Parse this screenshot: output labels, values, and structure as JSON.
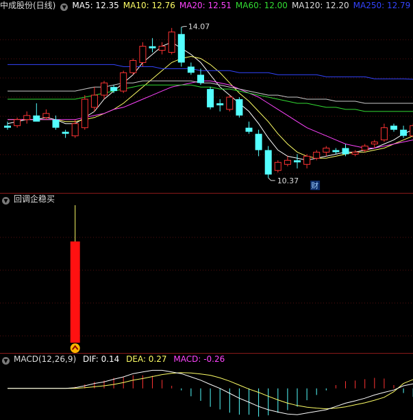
{
  "price_panel": {
    "title": "中成股份(日线)",
    "ma": [
      {
        "label": "MA5: 12.35",
        "color": "#ffffff"
      },
      {
        "label": "MA10: 12.76",
        "color": "#ffff66"
      },
      {
        "label": "MA20: 12.51",
        "color": "#ff44ff"
      },
      {
        "label": "MA60: 12.00",
        "color": "#33dd33"
      },
      {
        "label": "MA120: 12.20",
        "color": "#dddddd"
      },
      {
        "label": "MA250: 12.79",
        "color": "#3344ff"
      }
    ],
    "high_label": "14.07",
    "low_label": "10.37",
    "badge": "财",
    "up_color": "#ff3333",
    "down_color": "#54ffff"
  },
  "indicator_panel": {
    "title": "回调企稳买",
    "bar_color": "#ff1111"
  },
  "macd_panel": {
    "title": "MACD(12,26,9)",
    "dif": "DIF: 0.14",
    "dea": "DEA: 0.27",
    "macd": "MACD: -0.26",
    "dif_color": "#ffffff",
    "dea_color": "#ffff66",
    "macd_color": "#ff44ff"
  },
  "chart_data": {
    "type": "candlestick",
    "ohlc": [
      [
        11.65,
        11.75,
        11.55,
        11.6
      ],
      [
        11.65,
        11.85,
        11.6,
        11.8
      ],
      [
        11.8,
        12.0,
        11.7,
        11.9
      ],
      [
        11.9,
        12.2,
        11.85,
        11.75
      ],
      [
        11.85,
        12.05,
        11.8,
        11.95
      ],
      [
        11.8,
        11.9,
        11.55,
        11.6
      ],
      [
        11.5,
        11.55,
        11.35,
        11.45
      ],
      [
        11.4,
        11.8,
        11.35,
        11.7
      ],
      [
        11.6,
        12.4,
        11.55,
        12.3
      ],
      [
        12.1,
        12.6,
        12.0,
        12.4
      ],
      [
        12.4,
        12.75,
        12.3,
        12.7
      ],
      [
        12.6,
        12.65,
        12.45,
        12.5
      ],
      [
        12.5,
        13.0,
        12.45,
        12.95
      ],
      [
        12.95,
        13.3,
        12.9,
        13.25
      ],
      [
        13.2,
        13.7,
        13.1,
        13.6
      ],
      [
        13.6,
        13.8,
        13.45,
        13.55
      ],
      [
        13.5,
        13.7,
        13.4,
        13.6
      ],
      [
        13.45,
        14.05,
        13.4,
        13.95
      ],
      [
        13.9,
        14.07,
        13.1,
        13.2
      ],
      [
        13.1,
        13.2,
        12.9,
        12.95
      ],
      [
        12.9,
        13.05,
        12.65,
        12.7
      ],
      [
        12.55,
        12.6,
        12.05,
        12.1
      ],
      [
        12.2,
        12.3,
        12.0,
        12.15
      ],
      [
        12.05,
        12.4,
        12.0,
        12.35
      ],
      [
        12.3,
        12.35,
        11.85,
        11.9
      ],
      [
        11.6,
        11.75,
        11.45,
        11.5
      ],
      [
        11.45,
        11.55,
        10.9,
        11.05
      ],
      [
        11.05,
        11.15,
        10.37,
        10.45
      ],
      [
        10.55,
        10.8,
        10.5,
        10.75
      ],
      [
        10.7,
        10.9,
        10.65,
        10.8
      ],
      [
        10.8,
        10.95,
        10.6,
        10.75
      ],
      [
        10.7,
        10.95,
        10.6,
        10.9
      ],
      [
        10.85,
        11.05,
        10.8,
        11.0
      ],
      [
        11.0,
        11.15,
        10.9,
        11.1
      ],
      [
        11.05,
        11.1,
        10.95,
        11.0
      ],
      [
        11.1,
        11.2,
        10.9,
        10.95
      ],
      [
        10.95,
        11.05,
        10.9,
        11.0
      ],
      [
        11.05,
        11.2,
        11.0,
        11.15
      ],
      [
        11.2,
        11.3,
        11.1,
        11.25
      ],
      [
        11.3,
        11.7,
        11.25,
        11.6
      ],
      [
        11.65,
        11.7,
        11.5,
        11.55
      ],
      [
        11.55,
        11.65,
        11.35,
        11.4
      ],
      [
        11.4,
        11.7,
        11.35,
        11.65
      ]
    ],
    "ma_lines": {
      "MA5": [
        11.7,
        11.75,
        11.8,
        11.8,
        11.85,
        11.8,
        11.7,
        11.7,
        11.85,
        12.0,
        12.3,
        12.5,
        12.7,
        12.9,
        13.2,
        13.4,
        13.6,
        13.7,
        13.55,
        13.4,
        13.2,
        12.9,
        12.6,
        12.4,
        12.2,
        12.0,
        11.7,
        11.35,
        11.05,
        10.9,
        10.85,
        10.8,
        10.85,
        10.9,
        10.95,
        11.0,
        11.0,
        11.05,
        11.1,
        11.2,
        11.3,
        11.45,
        11.55
      ],
      "MA10": [
        11.8,
        11.8,
        11.8,
        11.8,
        11.8,
        11.8,
        11.75,
        11.75,
        11.8,
        11.85,
        11.95,
        12.05,
        12.2,
        12.4,
        12.6,
        12.8,
        13.0,
        13.2,
        13.3,
        13.35,
        13.3,
        13.15,
        12.95,
        12.7,
        12.45,
        12.25,
        12.0,
        11.75,
        11.45,
        11.2,
        11.0,
        10.9,
        10.85,
        10.85,
        10.9,
        10.95,
        11.0,
        11.0,
        11.05,
        11.1,
        11.2,
        11.3,
        11.4
      ],
      "MA20": [
        11.8,
        11.8,
        11.8,
        11.8,
        11.8,
        11.8,
        11.8,
        11.8,
        11.85,
        11.9,
        11.95,
        12.05,
        12.1,
        12.2,
        12.3,
        12.4,
        12.5,
        12.6,
        12.65,
        12.7,
        12.75,
        12.75,
        12.7,
        12.65,
        12.55,
        12.45,
        12.35,
        12.2,
        12.05,
        11.9,
        11.75,
        11.6,
        11.5,
        11.4,
        11.3,
        11.2,
        11.15,
        11.1,
        11.1,
        11.15,
        11.2,
        11.25,
        11.3
      ],
      "MA60": [
        12.3,
        12.3,
        12.3,
        12.3,
        12.3,
        12.3,
        12.3,
        12.3,
        12.35,
        12.4,
        12.45,
        12.5,
        12.55,
        12.6,
        12.65,
        12.65,
        12.65,
        12.65,
        12.65,
        12.65,
        12.6,
        12.6,
        12.55,
        12.55,
        12.5,
        12.45,
        12.4,
        12.35,
        12.3,
        12.25,
        12.2,
        12.2,
        12.15,
        12.1,
        12.1,
        12.05,
        12.05,
        12.0,
        12.0,
        12.0,
        12.0,
        12.0,
        12.0
      ],
      "MA120": [
        12.5,
        12.5,
        12.5,
        12.5,
        12.5,
        12.5,
        12.5,
        12.5,
        12.55,
        12.6,
        12.6,
        12.65,
        12.7,
        12.7,
        12.75,
        12.75,
        12.75,
        12.75,
        12.75,
        12.75,
        12.7,
        12.7,
        12.65,
        12.6,
        12.55,
        12.5,
        12.45,
        12.4,
        12.4,
        12.35,
        12.35,
        12.3,
        12.3,
        12.3,
        12.25,
        12.25,
        12.25,
        12.2,
        12.2,
        12.2,
        12.2,
        12.2,
        12.2
      ],
      "MA250": [
        13.15,
        13.15,
        13.15,
        13.15,
        13.15,
        13.15,
        13.15,
        13.15,
        13.15,
        13.15,
        13.15,
        13.15,
        13.1,
        13.1,
        13.1,
        13.1,
        13.05,
        13.05,
        13.05,
        13.05,
        13.0,
        13.0,
        13.0,
        13.0,
        12.95,
        12.95,
        12.95,
        12.95,
        12.9,
        12.9,
        12.9,
        12.9,
        12.9,
        12.85,
        12.85,
        12.85,
        12.85,
        12.85,
        12.8,
        12.8,
        12.8,
        12.8,
        12.79
      ]
    },
    "price_range": [
      10.1,
      14.4
    ],
    "signal_index": 7,
    "signal_value": 1.0,
    "macd": {
      "dif": [
        0.0,
        0.0,
        0.0,
        0.0,
        0.0,
        0.0,
        0.0,
        0.02,
        0.08,
        0.15,
        0.2,
        0.28,
        0.35,
        0.45,
        0.5,
        0.55,
        0.55,
        0.5,
        0.45,
        0.35,
        0.25,
        0.12,
        0.0,
        -0.15,
        -0.3,
        -0.42,
        -0.55,
        -0.65,
        -0.72,
        -0.78,
        -0.8,
        -0.75,
        -0.7,
        -0.65,
        -0.55,
        -0.45,
        -0.38,
        -0.3,
        -0.2,
        -0.12,
        -0.05,
        0.08,
        0.14
      ],
      "dea": [
        0.0,
        0.0,
        0.0,
        0.0,
        0.0,
        0.0,
        0.0,
        0.0,
        0.02,
        0.05,
        0.08,
        0.12,
        0.18,
        0.25,
        0.3,
        0.36,
        0.42,
        0.46,
        0.48,
        0.47,
        0.44,
        0.4,
        0.32,
        0.22,
        0.1,
        -0.02,
        -0.12,
        -0.24,
        -0.35,
        -0.45,
        -0.52,
        -0.57,
        -0.6,
        -0.62,
        -0.6,
        -0.56,
        -0.5,
        -0.44,
        -0.36,
        -0.27,
        -0.1,
        0.15,
        0.27
      ],
      "hist": [
        0.0,
        0.0,
        0.0,
        0.0,
        0.0,
        0.0,
        0.0,
        0.05,
        0.12,
        0.2,
        0.24,
        0.32,
        0.34,
        0.4,
        0.4,
        0.38,
        0.26,
        0.08,
        -0.06,
        -0.24,
        -0.38,
        -0.56,
        -0.64,
        -0.74,
        -0.8,
        -0.8,
        -0.86,
        -0.82,
        -0.74,
        -0.66,
        -0.56,
        -0.36,
        -0.2,
        -0.06,
        0.1,
        0.22,
        0.24,
        0.28,
        0.32,
        0.3,
        0.1,
        -0.14,
        -0.26
      ],
      "range": [
        -0.9,
        0.6
      ]
    }
  }
}
